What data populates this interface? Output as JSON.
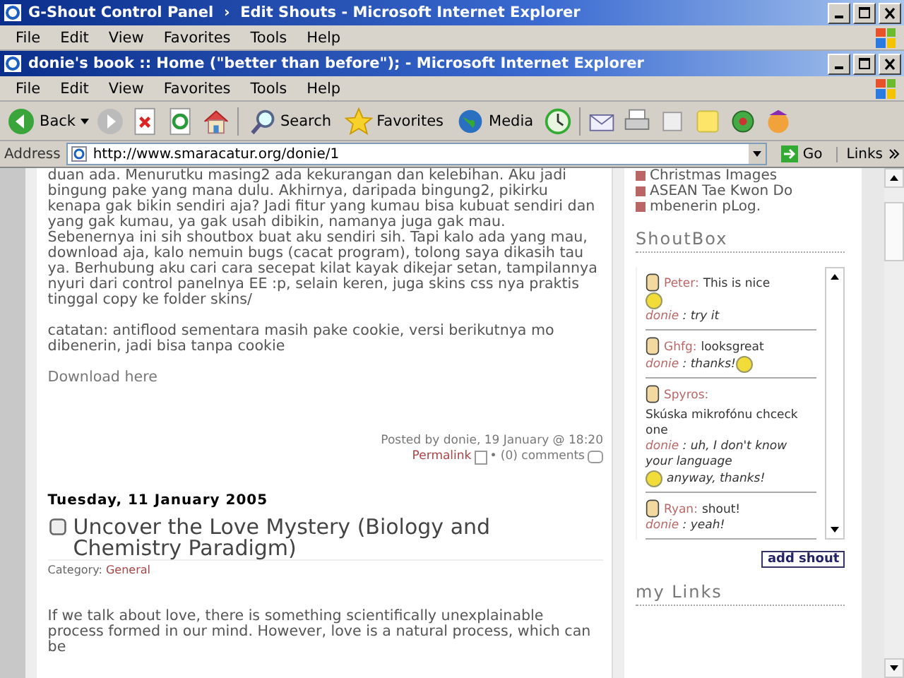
{
  "outer_window": {
    "title": "G-Shout Control Panel  ›  Edit Shouts - Microsoft Internet Explorer",
    "menu": [
      "File",
      "Edit",
      "View",
      "Favorites",
      "Tools",
      "Help"
    ]
  },
  "window": {
    "title": "donie's book :: Home (\"better than before\"); - Microsoft Internet Explorer",
    "menu": [
      "File",
      "Edit",
      "View",
      "Favorites",
      "Tools",
      "Help"
    ]
  },
  "toolbar": {
    "back": "Back",
    "search": "Search",
    "favorites": "Favorites",
    "media": "Media"
  },
  "address_bar": {
    "label": "Address",
    "url": "http://www.smaracatur.org/donie/1",
    "go": "Go",
    "links": "Links"
  },
  "post": {
    "paragraphs": [
      "duan ada. Menurutku masing2 ada kekurangan dan kelebihan. Aku jadi bingung pake yang mana dulu. Akhirnya, daripada bingung2, pikirku kenapa gak bikin sendiri aja? Jadi fitur yang kumau bisa kubuat sendiri dan yang gak kumau, ya gak usah dibikin, namanya juga gak mau.\nSebenernya ini sih shoutbox buat aku sendiri sih. Tapi kalo ada yang mau, download aja, kalo nemuin bugs (cacat program), tolong saya dikasih tau ya. Berhubung aku cari cara secepat kilat kayak dikejar setan, tampilannya nyuri dari control panelnya EE :p, selain keren, juga skins css nya praktis tinggal copy ke folder skins/",
      "catatan: antiflood sementara masih pake cookie, versi berikutnya mo dibenerin, jadi bisa tanpa cookie"
    ],
    "download_link": "Download here",
    "posted_by": "Posted by donie, 19 January @ 18:20",
    "permalink": "Permalink",
    "comments": "• (0) comments"
  },
  "next_post": {
    "date": "Tuesday, 11 January 2005",
    "title": "Uncover the Love Mystery (Biology and Chemistry Paradigm)",
    "category_label": "Category:",
    "category": "General",
    "body": "If we talk about love, there is something scientifically unexplainable process formed in our mind. However, love is a natural process, which can be"
  },
  "sidebar": {
    "links": [
      "Christmas Images",
      "ASEAN Tae Kwon Do",
      "mbenerin pLog."
    ],
    "shoutbox_heading": "ShoutBox",
    "shouts": [
      {
        "name": "Peter:",
        "message": "This is nice",
        "message_smiley": true,
        "replier": "donie",
        "reply": ": try it",
        "reply_smiley": false
      },
      {
        "name": "Ghfg:",
        "message": "looksgreat",
        "message_smiley": false,
        "replier": "donie",
        "reply": ": thanks!",
        "reply_smiley": true
      },
      {
        "name": "Spyros:",
        "message": "Skúska mikrofónu chceck one",
        "message_smiley": false,
        "replier": "donie",
        "reply": ": uh, I don't know your language",
        "reply_smiley": true,
        "reply_after": "anyway, thanks!"
      },
      {
        "name": "Ryan:",
        "message": "shout!",
        "message_smiley": false,
        "replier": "donie",
        "reply": ": yeah!",
        "reply_smiley": false
      }
    ],
    "add_shout": "add shout",
    "links_heading": "my Links"
  }
}
